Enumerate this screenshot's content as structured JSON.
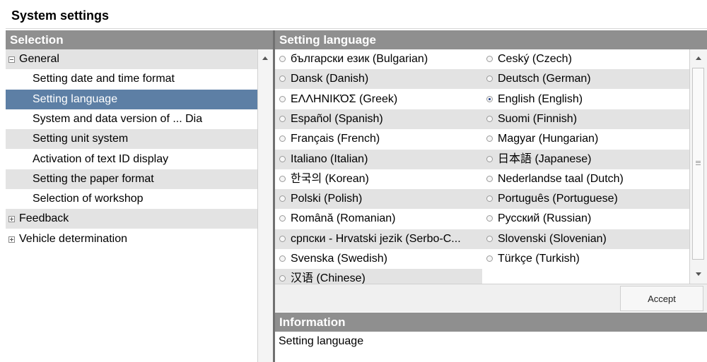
{
  "window": {
    "title": "System settings"
  },
  "selection_header": "Selection",
  "setting_header": "Setting language",
  "information_header": "Information",
  "information_text": "Setting language",
  "tree": [
    {
      "label": "General",
      "expander": "minus"
    },
    {
      "label": "Setting date and time format"
    },
    {
      "label": "Setting language",
      "selected": true
    },
    {
      "label": "System and data version of ... Dia"
    },
    {
      "label": "Setting unit system"
    },
    {
      "label": "Activation of text ID display"
    },
    {
      "label": "Setting the paper format"
    },
    {
      "label": "Selection of workshop"
    },
    {
      "label": "Feedback",
      "expander": "plus"
    },
    {
      "label": "Vehicle determination",
      "expander": "plus"
    }
  ],
  "languages": [
    {
      "label": "български език (Bulgarian)"
    },
    {
      "label": "Ceský (Czech)"
    },
    {
      "label": "Dansk (Danish)"
    },
    {
      "label": "Deutsch (German)"
    },
    {
      "label": "ΕΛΛΗΝΙΚΌΣ (Greek)"
    },
    {
      "label": "English (English)",
      "checked": true
    },
    {
      "label": "Español (Spanish)"
    },
    {
      "label": "Suomi (Finnish)"
    },
    {
      "label": "Français (French)"
    },
    {
      "label": "Magyar (Hungarian)"
    },
    {
      "label": "Italiano (Italian)"
    },
    {
      "label": "日本語 (Japanese)"
    },
    {
      "label": "한국의 (Korean)"
    },
    {
      "label": "Nederlandse taal (Dutch)"
    },
    {
      "label": "Polski (Polish)"
    },
    {
      "label": "Português (Portuguese)"
    },
    {
      "label": "Română (Romanian)"
    },
    {
      "label": "Русский (Russian)"
    },
    {
      "label": "српски - Hrvatski jezik (Serbo-C..."
    },
    {
      "label": "Slovenski (Slovenian)"
    },
    {
      "label": "Svenska (Swedish)"
    },
    {
      "label": "Türkçe (Turkish)"
    },
    {
      "label": "汉语 (Chinese)"
    }
  ],
  "accept_label": "Accept",
  "icons": {
    "expand": "plus-box-icon",
    "collapse": "minus-box-icon",
    "radio": "radio-button-icon",
    "scroll_up": "arrow-up-icon",
    "scroll_down": "arrow-down-icon"
  },
  "colors": {
    "header_bg": "#8f8f8f",
    "selected_row": "#5d7fa5",
    "alt_row": "#e3e3e3"
  }
}
